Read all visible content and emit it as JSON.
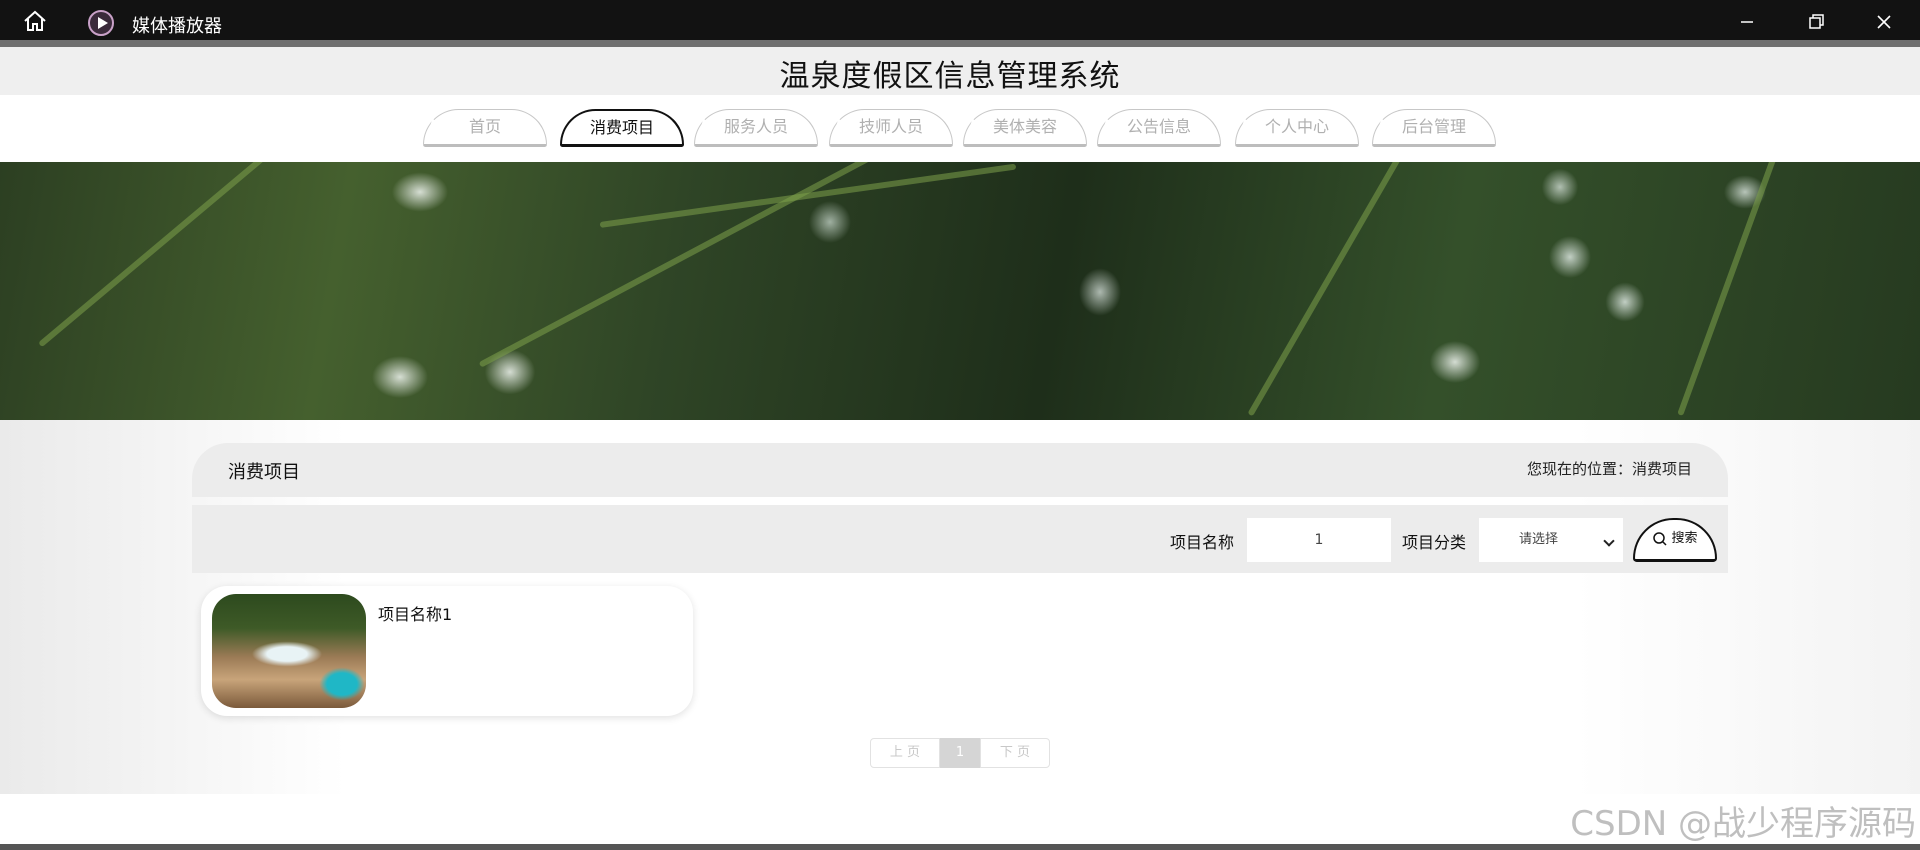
{
  "window": {
    "app_title": "媒体播放器"
  },
  "header": {
    "site_title": "温泉度假区信息管理系统"
  },
  "nav": {
    "items": [
      {
        "label": "首页"
      },
      {
        "label": "消费项目"
      },
      {
        "label": "服务人员"
      },
      {
        "label": "技师人员"
      },
      {
        "label": "美体美容"
      },
      {
        "label": "公告信息"
      },
      {
        "label": "个人中心"
      },
      {
        "label": "后台管理"
      }
    ],
    "active_index": 1
  },
  "section": {
    "title": "消费项目",
    "breadcrumb": "您现在的位置：消费项目"
  },
  "search": {
    "name_label": "项目名称",
    "name_value": "1",
    "category_label": "项目分类",
    "category_selected": "请选择",
    "button_label": "搜索"
  },
  "items": [
    {
      "name": "项目名称1"
    }
  ],
  "pagination": {
    "prev": "上 页",
    "current": "1",
    "next": "下 页"
  },
  "watermark": "CSDN @战少程序源码",
  "colors": {
    "titlebar": "#121212",
    "active_border": "#111111",
    "panel": "#ececec"
  }
}
